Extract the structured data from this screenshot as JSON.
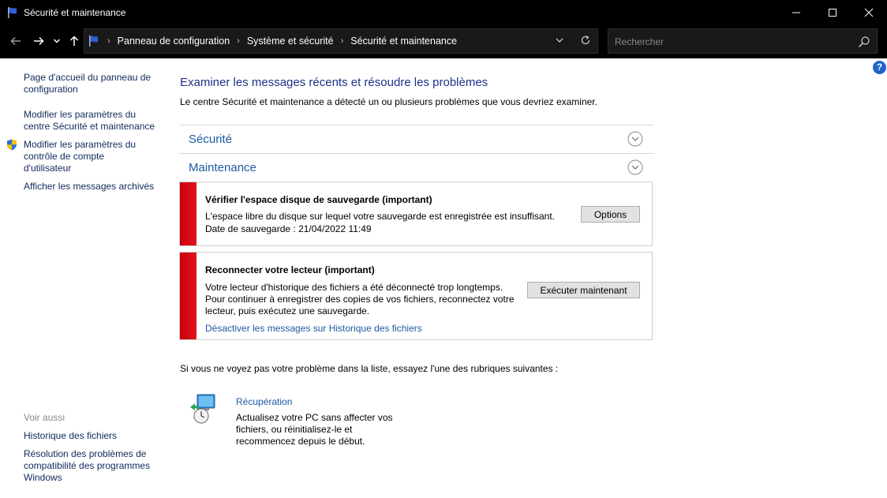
{
  "window": {
    "title": "Sécurité et maintenance",
    "icon": "flag-icon"
  },
  "navigation": {
    "breadcrumbs": [
      "Panneau de configuration",
      "Système et sécurité",
      "Sécurité et maintenance"
    ],
    "search_placeholder": "Rechercher"
  },
  "sidebar": {
    "links": [
      {
        "label": "Page d'accueil du panneau de configuration"
      },
      {
        "label": "Modifier les paramètres du centre Sécurité et maintenance"
      },
      {
        "label": "Modifier les paramètres du contrôle de compte d'utilisateur",
        "icon": "uac-shield-icon"
      },
      {
        "label": "Afficher les messages archivés"
      }
    ],
    "see_also_title": "Voir aussi",
    "see_also": [
      {
        "label": "Historique des fichiers"
      },
      {
        "label": "Résolution des problèmes de compatibilité des programmes Windows"
      }
    ]
  },
  "main": {
    "heading": "Examiner les messages récents et résoudre les problèmes",
    "intro": "Le centre Sécurité et maintenance a détecté un ou plusieurs problèmes que vous devriez examiner.",
    "sections": [
      {
        "label": "Sécurité"
      },
      {
        "label": "Maintenance"
      }
    ],
    "alerts": [
      {
        "title": "Vérifier l'espace disque de sauvegarde  (important)",
        "lines": [
          "L'espace libre du disque sur lequel votre sauvegarde est enregistrée est insuffisant.",
          "Date de sauvegarde : 21/04/2022 11:49"
        ],
        "button": "Options"
      },
      {
        "title": "Reconnecter votre lecteur  (important)",
        "lines": [
          "Votre lecteur d'historique des fichiers a été déconnecté trop longtemps.",
          "Pour continuer à enregistrer des copies de vos fichiers, reconnectez votre",
          "lecteur, puis exécutez une sauvegarde."
        ],
        "link": "Désactiver les messages sur Historique des fichiers",
        "button": "Exécuter maintenant"
      }
    ],
    "note": "Si vous ne voyez pas votre problème dans la liste, essayez l'une des rubriques suivantes :",
    "recovery": {
      "title": "Récupération",
      "lines": [
        "Actualisez votre PC sans affecter vos",
        "fichiers, ou réinitialisez-le et",
        "recommencez depuis le début."
      ]
    }
  },
  "colors": {
    "titlebar": "#000000",
    "link": "#1e5aa0",
    "heading": "#1e3287",
    "alert_bar": "#d40c16"
  }
}
